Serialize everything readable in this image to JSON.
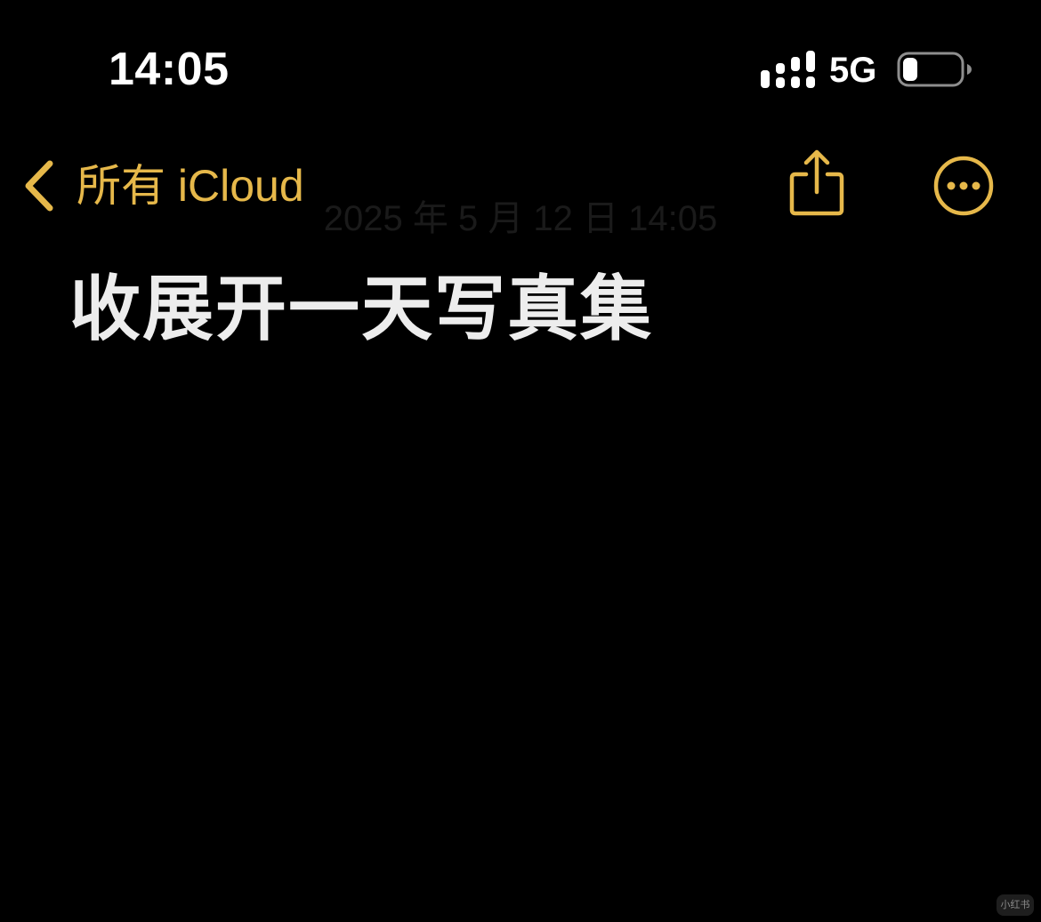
{
  "status_bar": {
    "time": "14:05",
    "network": "5G",
    "signal_icon": "cellular-signal-icon",
    "battery_icon": "battery-low-icon",
    "battery_level": 0.25
  },
  "nav": {
    "back_label": "所有 iCloud",
    "back_icon": "chevron-left-icon",
    "share_icon": "share-icon",
    "more_icon": "ellipsis-circle-icon",
    "accent_color": "#E6B84A"
  },
  "note": {
    "date": "2025 年 5 月 12 日 14:05",
    "title": "收展开一天写真集"
  },
  "watermark": {
    "text": "小红书"
  }
}
